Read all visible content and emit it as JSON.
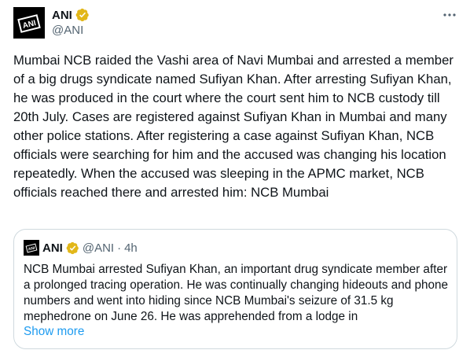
{
  "tweet": {
    "author": {
      "name": "ANI",
      "handle": "@ANI",
      "avatar_text": "ANI"
    },
    "text": "Mumbai NCB raided the Vashi area of Navi Mumbai and arrested a member of a big drugs syndicate named Sufiyan Khan. After arresting Sufiyan Khan, he was produced in the court where the court sent him to NCB custody till 20th July. Cases are registered against Sufiyan Khan in Mumbai and many other police stations. After registering a case against Sufiyan Khan, NCB officials were searching for him and the accused was changing his location repeatedly. When the accused was sleeping in the APMC market, NCB officials reached there and arrested him: NCB Mumbai",
    "more_icon": "more-horizontal-icon",
    "verified_icon": "verified-badge-icon",
    "verified_color": "#e2b719"
  },
  "quote": {
    "author": {
      "name": "ANI",
      "handle": "@ANI",
      "separator": "·",
      "time": "4h",
      "avatar_text": "ANI"
    },
    "text": "NCB Mumbai arrested Sufiyan Khan, an important drug syndicate member after a prolonged tracing operation. He was continually changing hideouts and phone numbers and went into hiding since NCB Mumbai's seizure of 31.5 kg mephedrone on June 26. He was apprehended from a lodge in",
    "show_more": "Show more"
  },
  "colors": {
    "text": "#0f1419",
    "secondary": "#536471",
    "link": "#1d9bf0",
    "border": "#cfd9de"
  }
}
